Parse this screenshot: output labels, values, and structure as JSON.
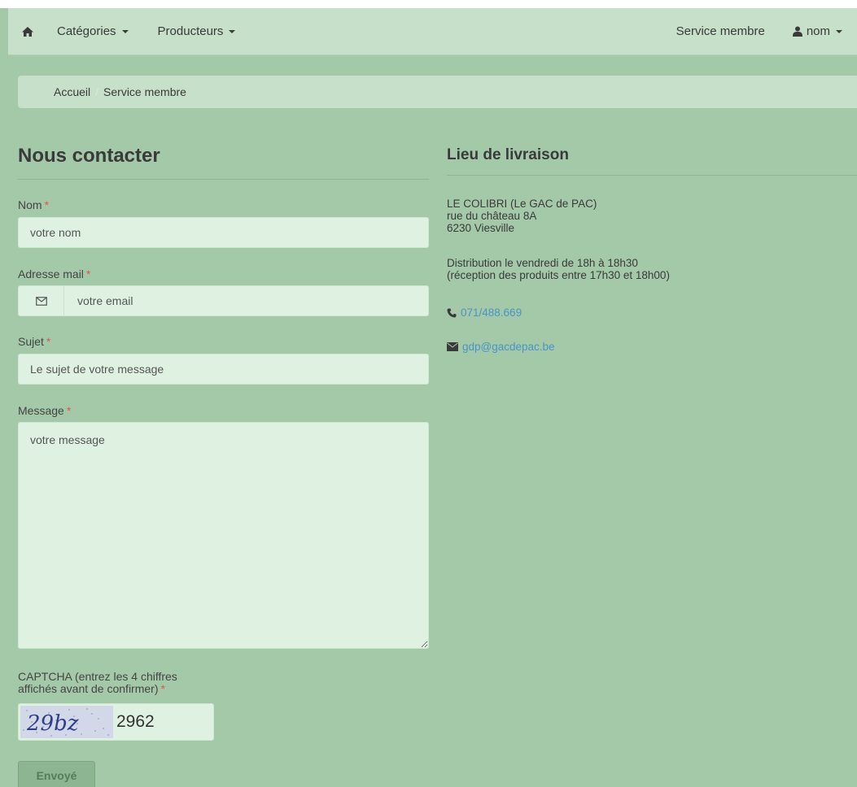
{
  "nav": {
    "categories_label": "Catégories",
    "producers_label": "Producteurs",
    "service_label": "Service membre",
    "user_label": "nom"
  },
  "breadcrumb": {
    "home": "Accueil",
    "current": "Service membre"
  },
  "contact": {
    "title": "Nous contacter",
    "required_mark": "*",
    "name_label": "Nom",
    "name_placeholder": "votre nom",
    "email_label": "Adresse mail",
    "email_placeholder": "votre email",
    "subject_label": "Sujet",
    "subject_placeholder": "Le sujet de votre message",
    "message_label": "Message",
    "message_placeholder": "votre message",
    "captcha_label_line1": "CAPTCHA (entrez les 4 chiffres",
    "captcha_label_line2": "affichés avant de confirmer)",
    "captcha_image_text": "29bz",
    "captcha_value": "2962",
    "submit_label": "Envoyé"
  },
  "location": {
    "title": "Lieu de livraison",
    "name": "LE COLIBRI (Le GAC de PAC)",
    "street": "rue du château 8A",
    "city": "6230 Viesville",
    "distribution": "Distribution le vendredi de 18h à 18h30",
    "reception": "(réception des produits entre 17h30 et 18h00)",
    "phone": "071/488.669",
    "email": "gdp@gacdepac.be"
  },
  "colors": {
    "background": "#a3c9a8",
    "navbar": "#c6e0c9",
    "input": "#dff2e1",
    "link": "#4a94c8",
    "required": "#e05555"
  }
}
